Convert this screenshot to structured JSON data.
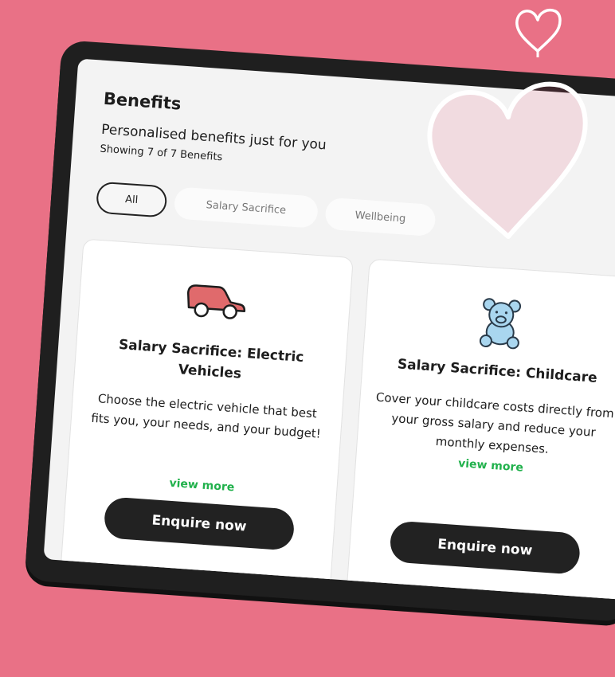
{
  "page": {
    "title": "Benefits",
    "subtitle": "Personalised benefits just for you",
    "count": "Showing 7 of 7 Benefits"
  },
  "filters": [
    {
      "label": "All",
      "active": true
    },
    {
      "label": "Salary Sacrifice",
      "active": false
    },
    {
      "label": "Wellbeing",
      "active": false
    }
  ],
  "cards": [
    {
      "icon": "car-icon",
      "title": "Salary Sacrifice: Electric Vehicles",
      "description": "Choose the electric vehicle that best fits you, your needs, and your budget!",
      "link": "view more",
      "button": "Enquire now"
    },
    {
      "icon": "teddy-bear-icon",
      "title": "Salary Sacrifice: Childcare",
      "description": "Cover your childcare costs directly from your gross salary and reduce your monthly expenses.",
      "link": "view more",
      "button": "Enquire now"
    }
  ],
  "colors": {
    "background": "#e97186",
    "accent_green": "#21b14c",
    "button_dark": "#222222",
    "car_red": "#e06a6c",
    "bear_blue": "#a9d6ef"
  }
}
